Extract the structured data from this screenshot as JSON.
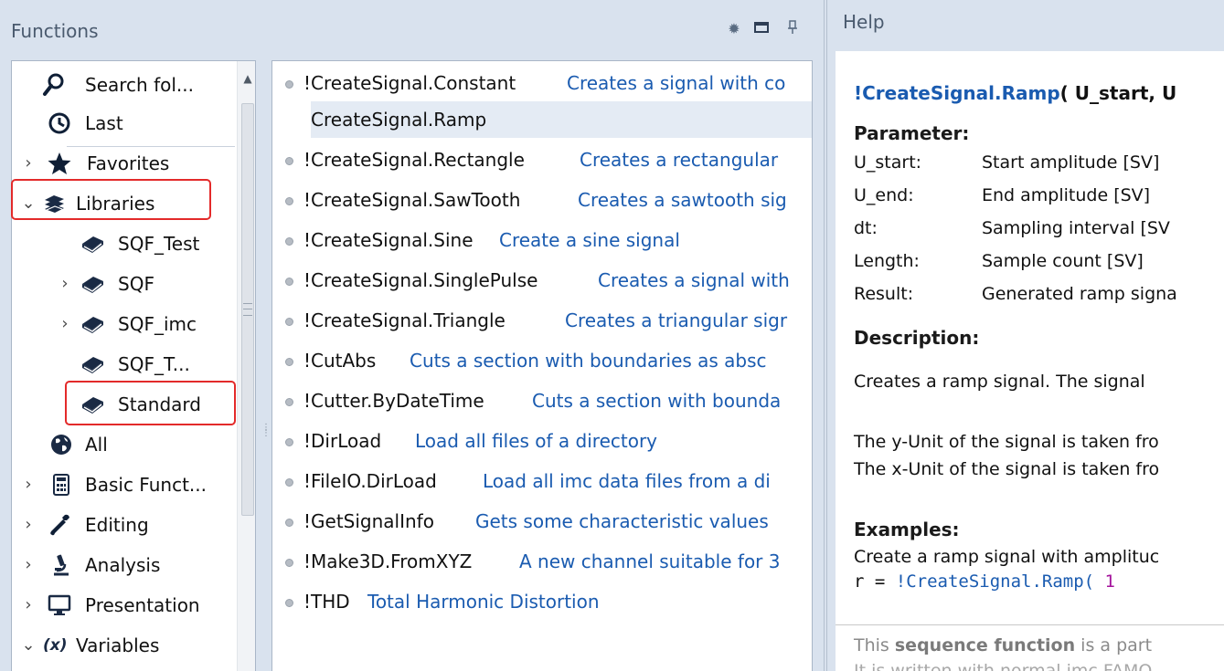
{
  "functions_panel": {
    "title": "Functions",
    "header_icons": [
      "gear-icon",
      "maximize-icon",
      "pin-icon"
    ]
  },
  "tree": {
    "items": [
      {
        "label": "Search fol...",
        "icon": "search-icon",
        "expander": ""
      },
      {
        "label": "Last",
        "icon": "clock-icon",
        "expander": ""
      },
      {
        "label": "Favorites",
        "icon": "star-icon",
        "expander": ">"
      },
      {
        "label": "Libraries",
        "icon": "books-icon",
        "expander": "v"
      },
      {
        "label": "SQF_Test",
        "icon": "book-icon",
        "expander": ""
      },
      {
        "label": "SQF",
        "icon": "book-icon",
        "expander": ">"
      },
      {
        "label": "SQF_imc",
        "icon": "book-icon",
        "expander": ">"
      },
      {
        "label": "SQF_T...",
        "icon": "book-icon",
        "expander": ""
      },
      {
        "label": "Standard",
        "icon": "book-icon",
        "expander": ""
      },
      {
        "label": "All",
        "icon": "globe-icon",
        "expander": ""
      },
      {
        "label": "Basic Funct...",
        "icon": "calculator-icon",
        "expander": ">"
      },
      {
        "label": "Editing",
        "icon": "wrench-icon",
        "expander": ">"
      },
      {
        "label": "Analysis",
        "icon": "microscope-icon",
        "expander": ">"
      },
      {
        "label": "Presentation",
        "icon": "monitor-icon",
        "expander": ">"
      },
      {
        "label": "Variables",
        "icon": "variable-icon",
        "expander": "v"
      }
    ]
  },
  "function_list": {
    "selected_index": 1,
    "items": [
      {
        "name": "!CreateSignal.Constant",
        "description": "Creates a signal with co"
      },
      {
        "name": "!CreateSignal.Ramp",
        "description": ""
      },
      {
        "name": "!CreateSignal.Rectangle",
        "description": "Creates a rectangular"
      },
      {
        "name": "!CreateSignal.SawTooth",
        "description": "Creates a sawtooth sig"
      },
      {
        "name": "!CreateSignal.Sine",
        "description": "Create a sine signal"
      },
      {
        "name": "!CreateSignal.SinglePulse",
        "description": "Creates a signal with"
      },
      {
        "name": "!CreateSignal.Triangle",
        "description": "Creates a triangular sigr"
      },
      {
        "name": "!CutAbs",
        "description": "Cuts a section with boundaries as absc"
      },
      {
        "name": "!Cutter.ByDateTime",
        "description": "Cuts a section with bounda"
      },
      {
        "name": "!DirLoad",
        "description": "Load all files of a directory"
      },
      {
        "name": "!FileIO.DirLoad",
        "description": "Load all imc data files from a di"
      },
      {
        "name": "!GetSignalInfo",
        "description": "Gets some characteristic values"
      },
      {
        "name": "!Make3D.FromXYZ",
        "description": "A new channel suitable for 3"
      },
      {
        "name": "!THD",
        "description": "Total Harmonic Distortion"
      }
    ]
  },
  "help": {
    "title": "Help",
    "func_name": "!CreateSignal.Ramp",
    "func_args": "( U_start, U",
    "parameter_heading": "Parameter:",
    "parameters": [
      {
        "name": "U_start:",
        "desc": "Start amplitude  [SV]"
      },
      {
        "name": "U_end:",
        "desc": "End amplitude  [SV]"
      },
      {
        "name": "dt:",
        "desc": "Sampling interval  [SV"
      },
      {
        "name": "Length:",
        "desc": "Sample count  [SV]"
      },
      {
        "name": "Result:",
        "desc": "Generated ramp signa"
      }
    ],
    "description_heading": "Description:",
    "description_lines": [
      "Creates a ramp signal. The signal",
      "The y-Unit of the signal is taken fro",
      "The x-Unit of the signal is taken fro"
    ],
    "examples_heading": "Examples:",
    "example_text": "Create a ramp signal with amplituc",
    "example_code_prefix": "r = ",
    "example_code_func": "!CreateSignal.Ramp(",
    "example_code_arg": " 1",
    "footer_prefix": "This ",
    "footer_bold": "sequence function",
    "footer_suffix": " is a part",
    "footer_cut": "It is written with normal imc FAMO"
  },
  "colors": {
    "accent_link": "#1a5bb0",
    "highlight_box": "#e32a2a",
    "selection": "#e4ebf4",
    "code_arg": "#a4139c"
  }
}
